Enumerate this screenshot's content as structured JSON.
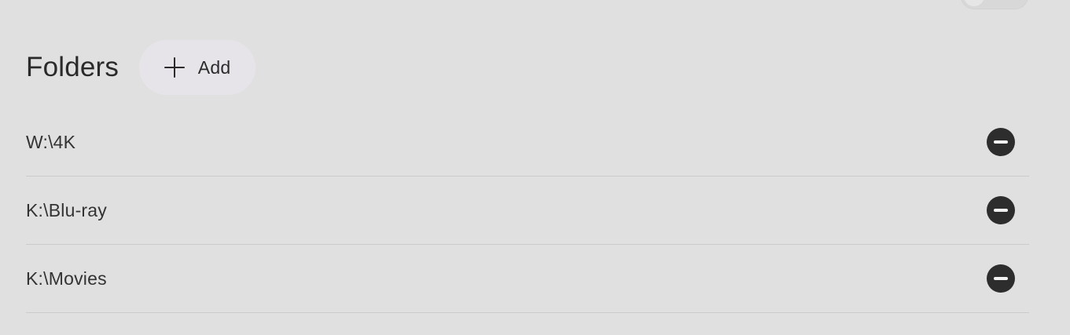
{
  "folders_section": {
    "title": "Folders",
    "add_label": "Add",
    "items": [
      {
        "path": "W:\\4K"
      },
      {
        "path": "K:\\Blu-ray"
      },
      {
        "path": "K:\\Movies"
      }
    ]
  },
  "icons": {
    "add": "plus-icon",
    "remove": "minus-circle-icon"
  },
  "colors": {
    "background": "#e0e0e0",
    "add_button_bg": "#e6e4e9",
    "remove_button": "#2d2d2d"
  }
}
